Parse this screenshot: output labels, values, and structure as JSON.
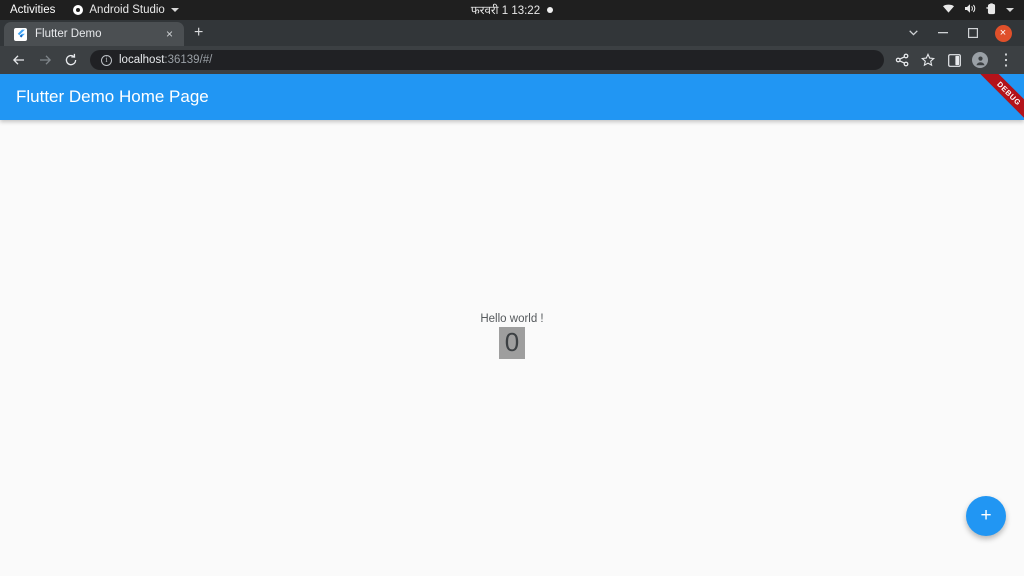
{
  "desktop": {
    "activities": "Activities",
    "app_menu": "Android Studio",
    "clock": "फरवरी 1  13:22",
    "icons": {
      "app_indicator": "record-dot-icon",
      "wifi": "wifi-icon",
      "volume": "volume-icon",
      "battery": "battery-icon",
      "system_menu": "chevron-down-icon"
    }
  },
  "browser": {
    "tab": {
      "title": "Flutter Demo",
      "favicon": "flutter-logo-icon",
      "close": "×"
    },
    "new_tab": "+",
    "window_controls": {
      "more": "⌄",
      "minimize": "−",
      "maximize": "□",
      "close": "×"
    },
    "toolbar": {
      "back": "←",
      "forward": "→",
      "reload": "⟳",
      "url_host": "localhost",
      "url_rest": ":36139/#/",
      "share": "share-icon",
      "bookmark": "star-icon",
      "side_panel": "side-panel-icon",
      "profile": "profile-avatar-icon",
      "menu": "⋮"
    }
  },
  "app": {
    "appbar_title": "Flutter Demo Home Page",
    "debug_banner": "DEBUG",
    "hello_text": "Hello world !",
    "counter_value": "0",
    "fab_label": "+",
    "colors": {
      "primary": "#2196f3",
      "background": "#fafafa",
      "debug_red": "#b3121a",
      "counter_highlight": "#9e9e9e"
    }
  }
}
